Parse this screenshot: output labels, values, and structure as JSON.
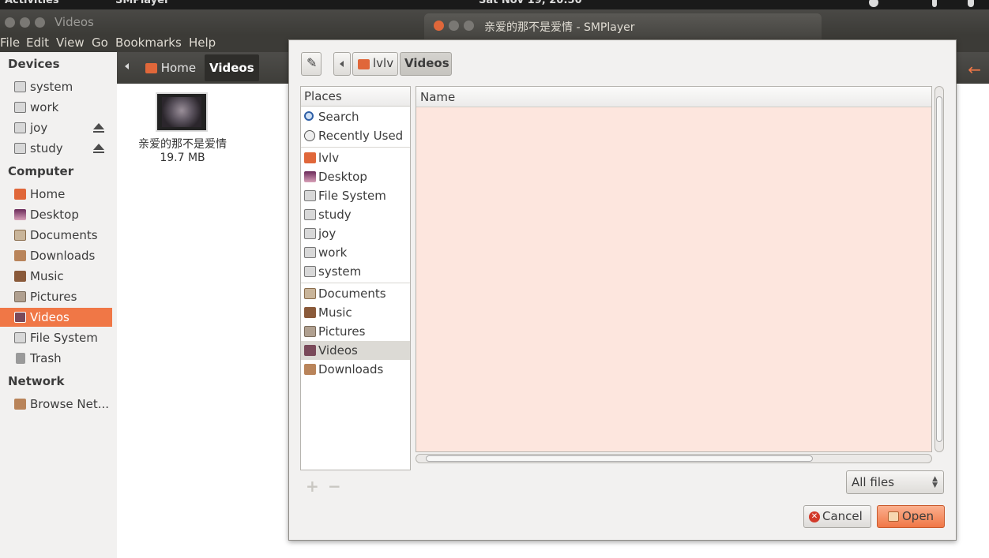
{
  "topbar": {
    "activities": "Activities",
    "app": "SMPlayer",
    "clock": "Sat Nov 19, 20:50"
  },
  "nautilus": {
    "title": "Videos",
    "menu": [
      "File",
      "Edit",
      "View",
      "Go",
      "Bookmarks",
      "Help"
    ],
    "breadcrumb": [
      "Home",
      "Videos"
    ],
    "sidebar": {
      "devices_header": "Devices",
      "devices": [
        "system",
        "work",
        "joy",
        "study"
      ],
      "computer_header": "Computer",
      "computer": [
        "Home",
        "Desktop",
        "Documents",
        "Downloads",
        "Music",
        "Pictures",
        "Videos",
        "File System",
        "Trash"
      ],
      "network_header": "Network",
      "network": [
        "Browse Net..."
      ]
    },
    "file": {
      "name": "亲爱的那不是爱情",
      "size": "19.7 MB"
    }
  },
  "dialog": {
    "title": "亲爱的那不是爱情 - SMPlayer",
    "path": [
      "lvlv",
      "Videos"
    ],
    "places_header": "Places",
    "places": {
      "group1": [
        "Search",
        "Recently Used"
      ],
      "group2": [
        "lvlv",
        "Desktop",
        "File System",
        "study",
        "joy",
        "work",
        "system"
      ],
      "group3": [
        "Documents",
        "Music",
        "Pictures",
        "Videos",
        "Downloads"
      ]
    },
    "name_header": "Name",
    "filter": "All files",
    "cancel": "Cancel",
    "open": "Open"
  },
  "colors": {
    "accent": "#f07746",
    "list_bg": "#fde6de",
    "title_bar": "#3c3b37"
  }
}
